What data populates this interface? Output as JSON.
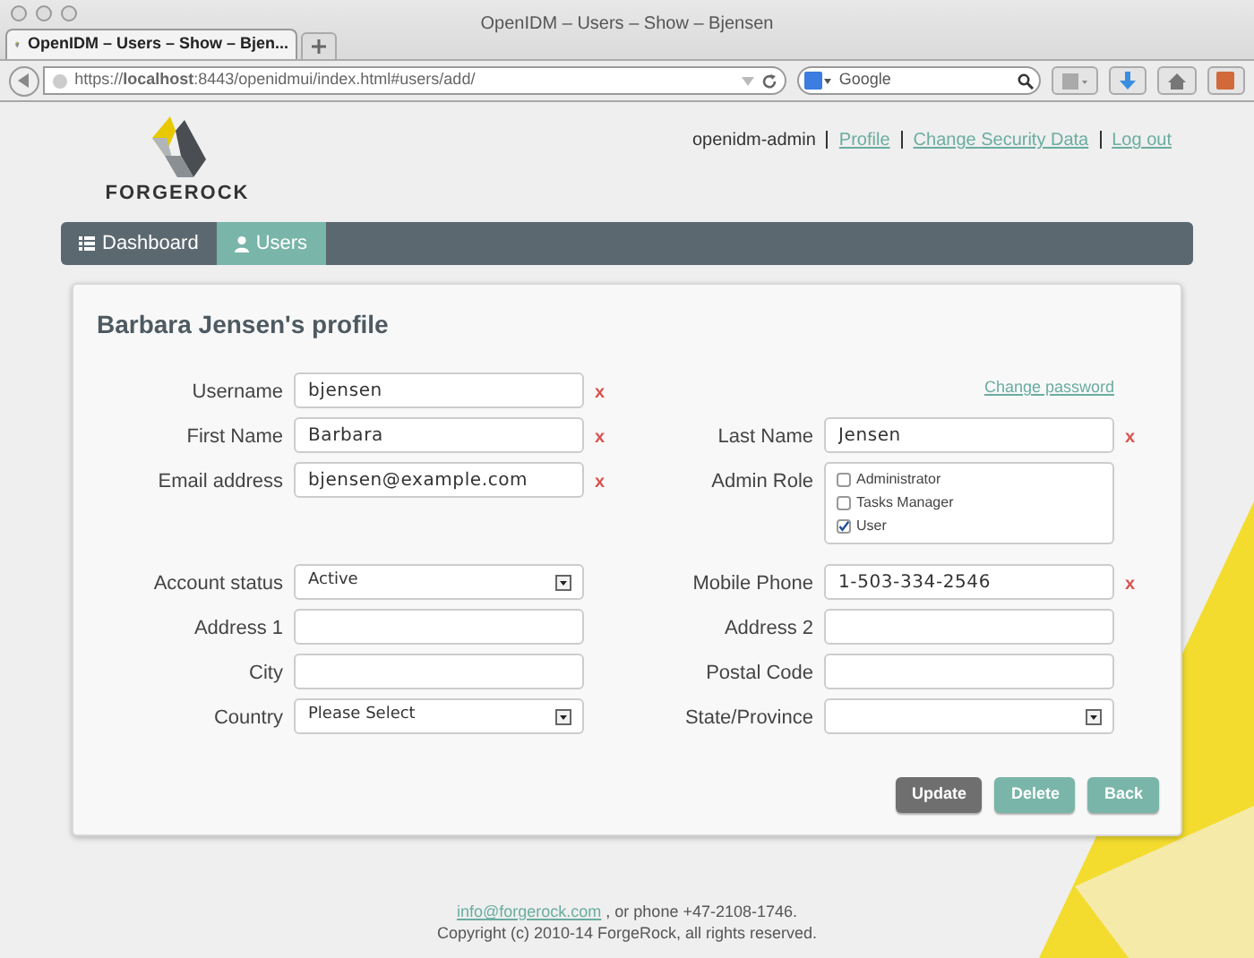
{
  "browser": {
    "title": "OpenIDM – Users – Show – Bjensen",
    "tab": "OpenIDM – Users – Show – Bjen...",
    "url": "https://**localhost**:8443/openidmui/index.html#users/add/",
    "search_placeholder": "Google"
  },
  "header": {
    "user": "openidm-admin",
    "links": [
      "Profile",
      "Change Security Data",
      "Log out"
    ],
    "logo_text": "FORGEROCK"
  },
  "nav": [
    {
      "label": "Dashboard",
      "selected": false
    },
    {
      "label": "Users",
      "selected": true
    }
  ],
  "profile": {
    "title": "Barbara Jensen's profile",
    "rows": [
      {
        "left": {
          "kind": "text",
          "label": "Username",
          "value": "bjensen",
          "required_mark": "x"
        },
        "right": {
          "kind": "link",
          "text": "Change password"
        }
      },
      {
        "left": {
          "kind": "text",
          "label": "First Name",
          "value": "Barbara",
          "required_mark": "x"
        },
        "right": {
          "kind": "text",
          "label": "Last Name",
          "value": "Jensen",
          "required_mark": "x"
        }
      },
      {
        "left": {
          "kind": "text",
          "label": "Email address",
          "value": "bjensen@example.com",
          "required_mark": "x"
        },
        "right": {
          "kind": "checkboxes",
          "label": "Admin Role",
          "options": [
            {
              "label": "Administrator",
              "checked": false
            },
            {
              "label": "Tasks Manager",
              "checked": false
            },
            {
              "label": "User",
              "checked": true
            }
          ]
        }
      },
      {
        "left": {
          "kind": "select",
          "label": "Account status",
          "value": "Active"
        },
        "right": {
          "kind": "text",
          "label": "Mobile Phone",
          "value": "1-503-334-2546",
          "required_mark": "x"
        }
      },
      {
        "left": {
          "kind": "text",
          "label": "Address 1"
        },
        "right": {
          "kind": "text",
          "label": "Address 2"
        }
      },
      {
        "left": {
          "kind": "text",
          "label": "City"
        },
        "right": {
          "kind": "text",
          "label": "Postal Code"
        }
      },
      {
        "left": {
          "kind": "select",
          "label": "Country",
          "value": "Please Select"
        },
        "right": {
          "kind": "select",
          "label": "State/Province"
        }
      }
    ],
    "buttons": [
      {
        "label": "Update",
        "kind": "primary"
      },
      {
        "label": "Delete",
        "kind": "secondary"
      },
      {
        "label": "Back",
        "kind": "secondary"
      }
    ]
  },
  "footer": {
    "email": "info@forgerock.com",
    "phone_text": ", or phone +47-2108-1746.",
    "copyright": "Copyright (c) 2010-14 ForgeRock, all rights reserved."
  }
}
